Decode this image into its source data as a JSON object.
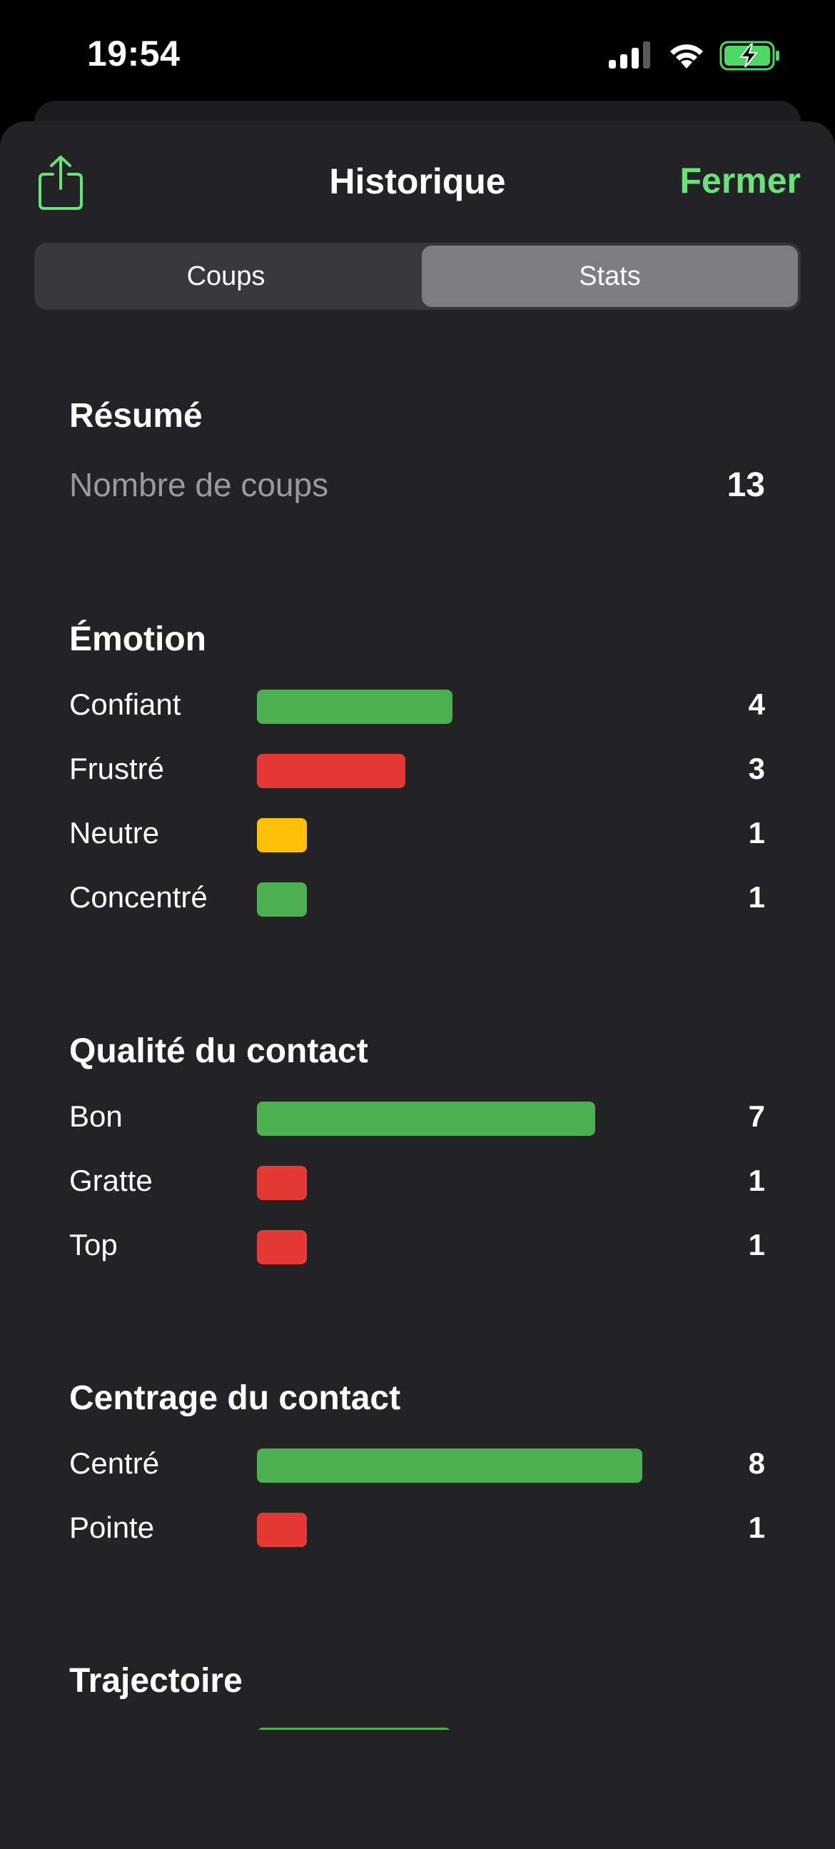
{
  "status_bar": {
    "time": "19:54"
  },
  "header": {
    "title": "Historique",
    "close_label": "Fermer",
    "share_icon": "share-icon"
  },
  "tabs": [
    {
      "label": "Coups",
      "selected": false
    },
    {
      "label": "Stats",
      "selected": true
    }
  ],
  "colors": {
    "accent": "#6be17e",
    "green": "#4caf50",
    "red": "#e53935",
    "yellow": "#ffc107"
  },
  "summary": {
    "title": "Résumé",
    "label": "Nombre de coups",
    "value": "13"
  },
  "emotion": {
    "title": "Émotion",
    "rows": [
      {
        "label": "Confiant",
        "value": "4",
        "count": 4,
        "color": "#4caf50"
      },
      {
        "label": "Frustré",
        "value": "3",
        "count": 3,
        "color": "#e53935"
      },
      {
        "label": "Neutre",
        "value": "1",
        "count": 1,
        "color": "#ffc107"
      },
      {
        "label": "Concentré",
        "value": "1",
        "count": 1,
        "color": "#4caf50"
      }
    ]
  },
  "contact_quality": {
    "title": "Qualité du contact",
    "rows": [
      {
        "label": "Bon",
        "value": "7",
        "count": 7,
        "color": "#4caf50"
      },
      {
        "label": "Gratte",
        "value": "1",
        "count": 1,
        "color": "#e53935"
      },
      {
        "label": "Top",
        "value": "1",
        "count": 1,
        "color": "#e53935"
      }
    ]
  },
  "contact_centering": {
    "title": "Centrage du contact",
    "rows": [
      {
        "label": "Centré",
        "value": "8",
        "count": 8,
        "color": "#4caf50"
      },
      {
        "label": "Pointe",
        "value": "1",
        "count": 1,
        "color": "#e53935"
      }
    ]
  },
  "trajectory": {
    "title": "Trajectoire"
  }
}
